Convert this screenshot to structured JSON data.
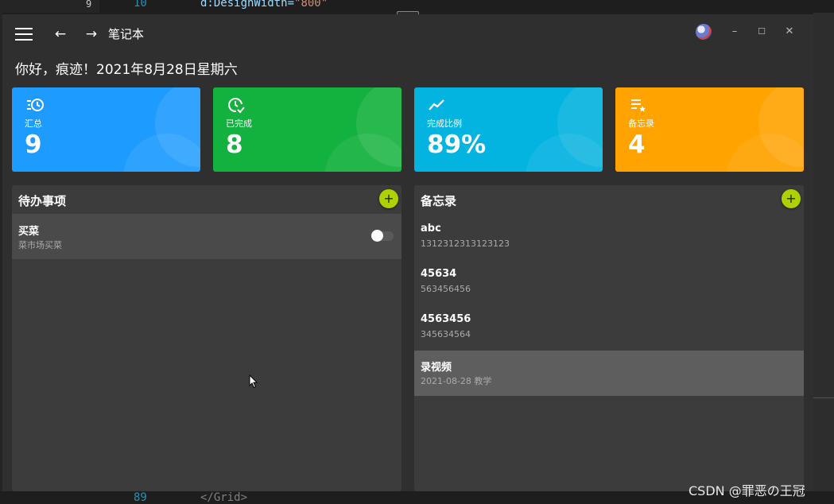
{
  "background_editor": {
    "top_line_number": "10",
    "top_code_attr": "d:DesignWidth=",
    "top_code_value": "\"800\"",
    "gutter_number": "9",
    "bottom_line_number": "89",
    "bottom_code": "</Grid>"
  },
  "titlebar": {
    "app_title": "笔记本",
    "back_glyph": "←",
    "forward_glyph": "→",
    "minimize_glyph": "–",
    "maximize_glyph": "☐",
    "close_glyph": "✕"
  },
  "greeting": "你好，痕迹！2021年8月28日星期六",
  "stats": [
    {
      "label": "汇总",
      "value": "9",
      "icon": "clock-list-icon",
      "color": "#1e9bff"
    },
    {
      "label": "已完成",
      "value": "8",
      "icon": "clock-check-icon",
      "color": "#13b13d"
    },
    {
      "label": "完成比例",
      "value": "89%",
      "icon": "trend-chart-icon",
      "color": "#03b3e0"
    },
    {
      "label": "备忘录",
      "value": "4",
      "icon": "playlist-star-icon",
      "color": "#ffa300"
    }
  ],
  "todo_panel": {
    "title": "待办事项",
    "add_glyph": "+",
    "items": [
      {
        "title": "买菜",
        "subtitle": "菜市场买菜",
        "done": false
      }
    ]
  },
  "memo_panel": {
    "title": "备忘录",
    "add_glyph": "+",
    "items": [
      {
        "title": "abc",
        "subtitle": "1312312313123123"
      },
      {
        "title": "45634",
        "subtitle": "563456456"
      },
      {
        "title": "4563456",
        "subtitle": "345634564"
      },
      {
        "title": "录视频",
        "subtitle": "2021-08-28 教学",
        "selected": true
      }
    ]
  },
  "watermark": "CSDN @罪恶の王冠",
  "colors": {
    "accent_add": "#aed100",
    "window_bg": "#2f2f2f",
    "panel_bg": "#3c3c3c"
  }
}
